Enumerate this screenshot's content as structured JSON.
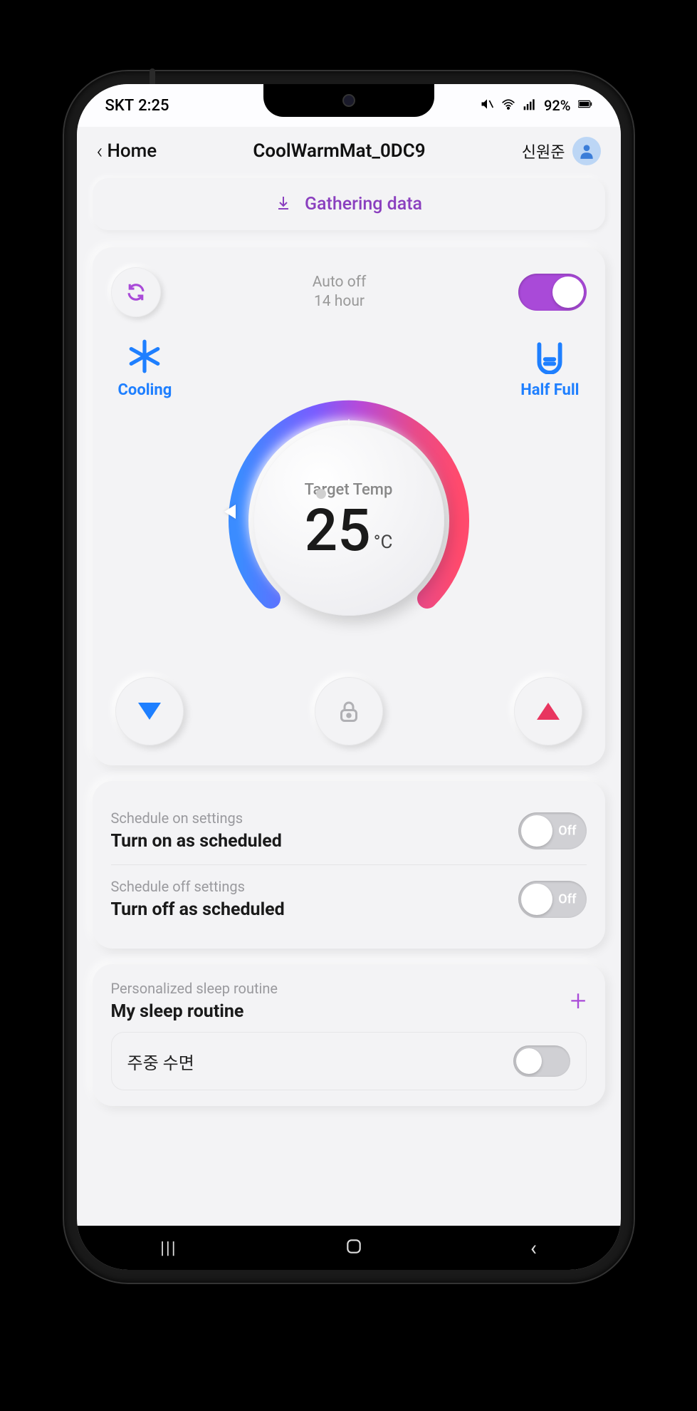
{
  "status": {
    "carrier": "SKT",
    "time": "2:25",
    "battery": "92%"
  },
  "header": {
    "back_label": "Home",
    "title": "CoolWarmMat_0DC9",
    "user_name": "신원준"
  },
  "banner": {
    "text": "Gathering data"
  },
  "main": {
    "auto_off_line1": "Auto off",
    "auto_off_line2": "14 hour",
    "power_on": true,
    "mode_left_label": "Cooling",
    "mode_right_label": "Half Full",
    "target_label": "Target Temp",
    "temp_value": "25",
    "temp_unit": "°C"
  },
  "schedule": {
    "on_caption": "Schedule on settings",
    "on_title": "Turn on as scheduled",
    "on_state": "Off",
    "off_caption": "Schedule off settings",
    "off_title": "Turn off as scheduled",
    "off_state": "Off"
  },
  "routine": {
    "caption": "Personalized sleep routine",
    "title": "My sleep routine",
    "items": [
      {
        "name": "주중 수면"
      }
    ]
  }
}
